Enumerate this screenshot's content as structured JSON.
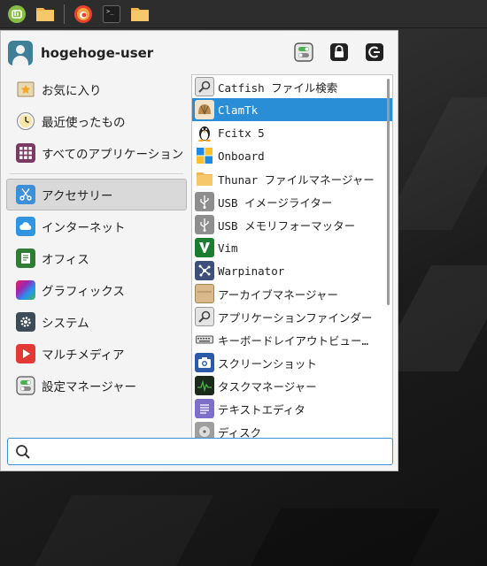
{
  "panel": {
    "buttons": [
      {
        "name": "whisker-menu-icon"
      },
      {
        "name": "folder-icon"
      },
      {
        "name": "firefox-icon"
      },
      {
        "name": "terminal-icon"
      },
      {
        "name": "file-manager-icon"
      }
    ]
  },
  "user": {
    "name": "hogehoge-user"
  },
  "categories": [
    {
      "label": "お気に入り",
      "icon": "star-icon"
    },
    {
      "label": "最近使ったもの",
      "icon": "clock-icon"
    },
    {
      "label": "すべてのアプリケーション",
      "icon": "grid-icon"
    },
    {
      "label": "アクセサリー",
      "icon": "scissors-icon",
      "active": true
    },
    {
      "label": "インターネット",
      "icon": "cloud-icon"
    },
    {
      "label": "オフィス",
      "icon": "document-icon"
    },
    {
      "label": "グラフィックス",
      "icon": "graphics-icon"
    },
    {
      "label": "システム",
      "icon": "gear-icon"
    },
    {
      "label": "マルチメディア",
      "icon": "play-icon"
    },
    {
      "label": "設定マネージャー",
      "icon": "toggle-icon"
    }
  ],
  "apps": [
    {
      "label": "Catfish ファイル検索",
      "icon": "magnifier-icon"
    },
    {
      "label": "ClamTk",
      "icon": "shell-icon",
      "selected": true
    },
    {
      "label": "Fcitx 5",
      "icon": "penguin-icon"
    },
    {
      "label": "Onboard",
      "icon": "keyboard-icon"
    },
    {
      "label": "Thunar ファイルマネージャー",
      "icon": "folder-icon"
    },
    {
      "label": "USB イメージライター",
      "icon": "usb-icon"
    },
    {
      "label": "USB メモリフォーマッター",
      "icon": "usb-icon"
    },
    {
      "label": "Vim",
      "icon": "vim-icon"
    },
    {
      "label": "Warpinator",
      "icon": "warpinator-icon"
    },
    {
      "label": "アーカイブマネージャー",
      "icon": "archive-icon"
    },
    {
      "label": "アプリケーションファインダー",
      "icon": "magnifier-icon"
    },
    {
      "label": "キーボードレイアウトビュー…",
      "icon": "keyboard-icon"
    },
    {
      "label": "スクリーンショット",
      "icon": "camera-icon"
    },
    {
      "label": "タスクマネージャー",
      "icon": "monitor-icon"
    },
    {
      "label": "テキストエディタ",
      "icon": "text-editor-icon"
    },
    {
      "label": "ディスク",
      "icon": "disk-icon"
    }
  ],
  "search": {
    "placeholder": "",
    "value": ""
  }
}
